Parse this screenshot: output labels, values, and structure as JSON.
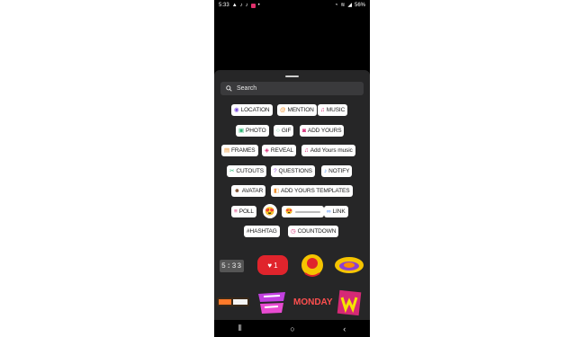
{
  "status_bar": {
    "time": "5:33",
    "battery": "56%"
  },
  "search": {
    "placeholder": "Search"
  },
  "stickers": {
    "location": "LOCATION",
    "mention": "MENTION",
    "music": "MUSIC",
    "photo": "PHOTO",
    "gif": "GIF",
    "add_yours": "ADD YOURS",
    "frames": "FRAMES",
    "reveal": "REVEAL",
    "add_yours_music": "Add Yours music",
    "cutouts": "CUTOUTS",
    "questions": "QUESTIONS",
    "notify": "NOTIFY",
    "avatar": "AVATAR",
    "add_yours_templates": "ADD YOURS TEMPLATES",
    "poll": "POLL",
    "link": "LINK",
    "hashtag": "#HASHTAG",
    "countdown": "COUNTDOWN"
  },
  "gallery": {
    "clock": "5:33",
    "like_count": "1",
    "monday": "MONDAY"
  },
  "colors": {
    "sheet": "#262627",
    "chip": "#ffffff",
    "like": "#e0242c",
    "accent_pink": "#e1306c"
  }
}
